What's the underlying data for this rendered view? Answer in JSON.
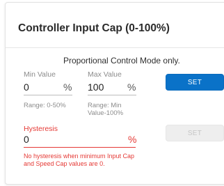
{
  "card": {
    "title": "Controller Input Cap (0-100%)",
    "mode_note": "Proportional Control Mode only."
  },
  "min_value": {
    "label": "Min Value",
    "value": "0",
    "unit": "%",
    "hint": "Range: 0-50%"
  },
  "max_value": {
    "label": "Max Value",
    "value": "100",
    "unit": "%",
    "hint": "Range: Min Value-100%"
  },
  "set_button": {
    "label": "SET",
    "color": "#0a72c8",
    "enabled": true
  },
  "hysteresis": {
    "label": "Hysteresis",
    "value": "0",
    "unit": "%",
    "error_text": "No hysteresis when minimum Input Cap and Speed Cap values are 0.",
    "error_color": "#e53935"
  },
  "hysteresis_set_button": {
    "label": "SET",
    "enabled": false
  }
}
